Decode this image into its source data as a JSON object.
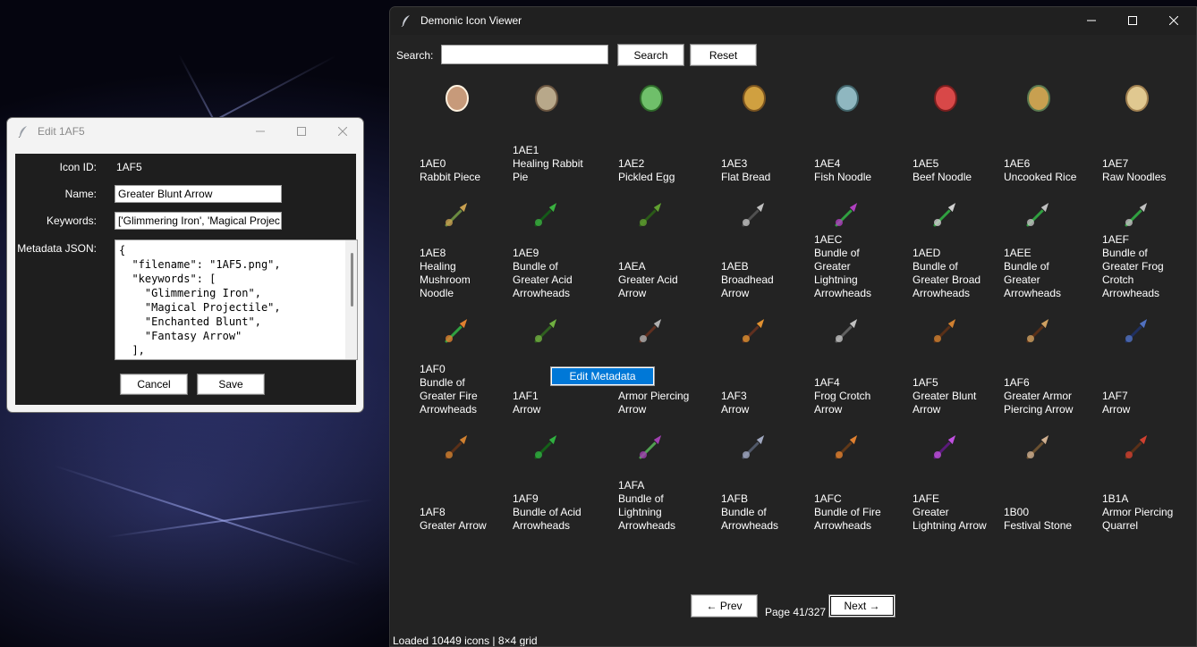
{
  "viewer": {
    "title": "Demonic Icon Viewer",
    "search_label": "Search:",
    "search_value": "",
    "search_button": "Search",
    "reset_button": "Reset",
    "prev_button": "← Prev",
    "next_button": "Next →",
    "page_label": "Page 41/327",
    "status": "Loaded 10449 icons | 8×4 grid",
    "context_menu_item": "Edit Metadata",
    "icons": [
      {
        "label": "1AE0\nRabbit Piece",
        "icon": "drumstick-icon"
      },
      {
        "label": "1AE1\nHealing Rabbit\nPie",
        "icon": "pie-icon"
      },
      {
        "label": "1AE2\nPickled Egg",
        "icon": "egg-icon"
      },
      {
        "label": "1AE3\nFlat Bread",
        "icon": "bread-icon"
      },
      {
        "label": "1AE4\nFish Noodle",
        "icon": "fish-noodle-icon"
      },
      {
        "label": "1AE5\nBeef Noodle",
        "icon": "beef-noodle-icon"
      },
      {
        "label": "1AE6\nUncooked Rice",
        "icon": "rice-icon"
      },
      {
        "label": "1AE7\nRaw Noodles",
        "icon": "noodles-icon"
      },
      {
        "label": "1AE8\nHealing\nMushroom\nNoodle",
        "icon": "mushroom-noodle-icon"
      },
      {
        "label": "1AE9\nBundle of\nGreater Acid\nArrowheads",
        "icon": "acid-arrowheads-icon"
      },
      {
        "label": "1AEA\nGreater Acid\nArrow",
        "icon": "acid-arrow-icon"
      },
      {
        "label": "1AEB\nBroadhead\nArrow",
        "icon": "broadhead-arrow-icon"
      },
      {
        "label": "1AEC\nBundle of\nGreater\nLightning\nArrowheads",
        "icon": "lightning-arrowheads-icon"
      },
      {
        "label": "1AED\nBundle of\nGreater Broad\nArrowheads",
        "icon": "broad-arrowheads-icon"
      },
      {
        "label": "1AEE\nBundle of\nGreater\nArrowheads",
        "icon": "arrowheads-icon"
      },
      {
        "label": "1AEF\nBundle of\nGreater Frog\nCrotch\nArrowheads",
        "icon": "frog-crotch-arrowheads-icon"
      },
      {
        "label": "1AF0\nBundle of\nGreater Fire\nArrowheads",
        "icon": "fire-arrowheads-icon"
      },
      {
        "label": "1AF1\nArrow",
        "icon": "green-arrow-icon"
      },
      {
        "label": "Armor Piercing\nArrow",
        "icon": "armor-piercing-arrow-icon"
      },
      {
        "label": "1AF3\nArrow",
        "icon": "fire-arrow-icon"
      },
      {
        "label": "1AF4\nFrog Crotch\nArrow",
        "icon": "frog-crotch-arrow-icon"
      },
      {
        "label": "1AF5\nGreater Blunt\nArrow",
        "icon": "blunt-arrow-icon"
      },
      {
        "label": "1AF6\nGreater Armor\nPiercing Arrow",
        "icon": "greater-armor-piercing-arrow-icon"
      },
      {
        "label": "1AF7\nArrow",
        "icon": "blue-arrow-icon"
      },
      {
        "label": "1AF8\nGreater Arrow",
        "icon": "greater-arrow-icon"
      },
      {
        "label": "1AF9\nBundle of Acid\nArrowheads",
        "icon": "bundle-acid-arrowheads-icon"
      },
      {
        "label": "1AFA\nBundle of\nLightning\nArrowheads",
        "icon": "bundle-lightning-arrowheads-icon"
      },
      {
        "label": "1AFB\nBundle of\nArrowheads",
        "icon": "bundle-arrowheads-icon"
      },
      {
        "label": "1AFC\nBundle of Fire\nArrowheads",
        "icon": "bundle-fire-arrowheads-icon"
      },
      {
        "label": "1AFE\nGreater\nLightning Arrow",
        "icon": "lightning-arrow-icon"
      },
      {
        "label": "1B00\nFestival Stone",
        "icon": "festival-stone-icon"
      },
      {
        "label": "1B1A\nArmor Piercing\nQuarrel",
        "icon": "quarrel-icon"
      }
    ]
  },
  "editor": {
    "title": "Edit 1AF5",
    "icon_id_label": "Icon ID:",
    "icon_id_value": "1AF5",
    "name_label": "Name:",
    "name_value": "Greater Blunt Arrow",
    "keywords_label": "Keywords:",
    "keywords_value": "['Glimmering Iron', 'Magical Projec",
    "json_label": "Metadata JSON:",
    "json_text": "{\n  \"filename\": \"1AF5.png\",\n  \"keywords\": [\n    \"Glimmering Iron\",\n    \"Magical Projectile\",\n    \"Enchanted Blunt\",\n    \"Fantasy Arrow\"\n  ],",
    "cancel_button": "Cancel",
    "save_button": "Save"
  }
}
